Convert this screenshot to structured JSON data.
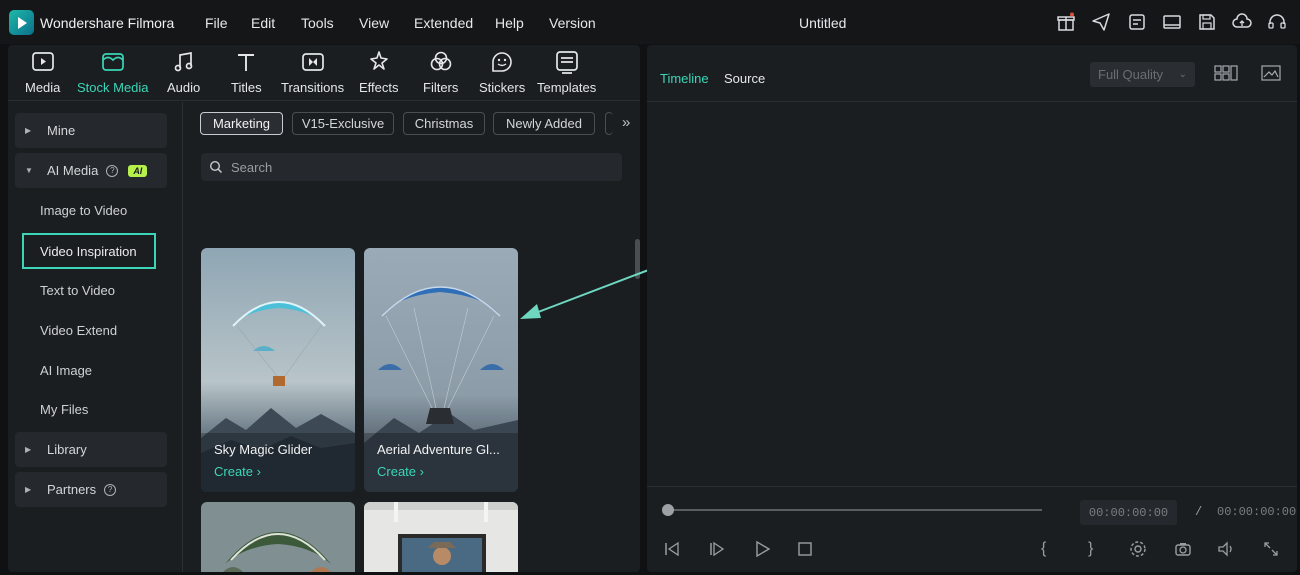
{
  "app": {
    "name": "Wondershare Filmora",
    "document_title": "Untitled",
    "menu": [
      "File",
      "Edit",
      "Tools",
      "View",
      "Extended",
      "Help",
      "Version"
    ]
  },
  "colors": {
    "accent": "#3bd6b8",
    "ai_badge": "#b7f04a",
    "panel": "#1b1e21",
    "background": "#0f1113"
  },
  "toolbar_icons": [
    "gift-icon",
    "send-icon",
    "checklist-icon",
    "display-icon",
    "save-icon",
    "cloud-upload-icon",
    "headset-icon"
  ],
  "media_tabs": [
    {
      "label": "Media",
      "icon": "media-icon"
    },
    {
      "label": "Stock Media",
      "icon": "stock-media-icon",
      "active": true
    },
    {
      "label": "Audio",
      "icon": "music-note-icon"
    },
    {
      "label": "Titles",
      "icon": "text-t-icon"
    },
    {
      "label": "Transitions",
      "icon": "transitions-icon"
    },
    {
      "label": "Effects",
      "icon": "effects-icon"
    },
    {
      "label": "Filters",
      "icon": "filters-icon"
    },
    {
      "label": "Stickers",
      "icon": "stickers-icon"
    },
    {
      "label": "Templates",
      "icon": "templates-icon"
    }
  ],
  "sidebar": {
    "mine": "Mine",
    "ai_media": "AI Media",
    "ai_badge": "AI",
    "ai_items": [
      "Image to Video",
      "Video Inspiration",
      "Text to Video",
      "Video Extend",
      "AI Image",
      "My Files"
    ],
    "active_item": "Video Inspiration",
    "library": "Library",
    "partners": "Partners"
  },
  "filters": [
    "Marketing",
    "V15-Exclusive",
    "Christmas",
    "Newly Added"
  ],
  "active_filter": "Marketing",
  "search": {
    "placeholder": "Search"
  },
  "cards": [
    {
      "title": "Sky Magic Glider",
      "action": "Create"
    },
    {
      "title": "Aerial Adventure Gl...",
      "action": "Create"
    }
  ],
  "preview": {
    "tabs": [
      "Timeline",
      "Source"
    ],
    "active_tab": "Timeline",
    "quality": "Full Quality",
    "current_time": "00:00:00:00",
    "separator": "/",
    "total_time": "00:00:00:00",
    "progress": 0
  }
}
